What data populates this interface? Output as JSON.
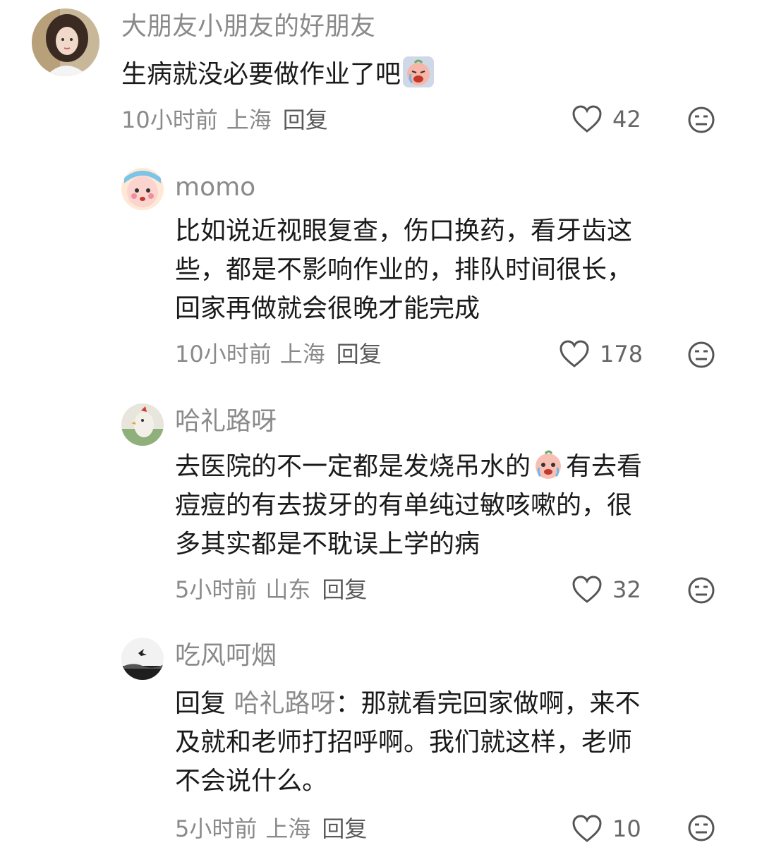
{
  "comments": [
    {
      "username": "大朋友小朋友的好朋友",
      "text_before": "生病就没必要做作业了吧",
      "emoji": "crying-peach-emoji",
      "text_after": "",
      "time": "10小时前",
      "location": "上海",
      "reply": "回复",
      "likes": "42"
    },
    {
      "username": "momo",
      "text_line1": "比如说近视眼复查，伤口换药，看牙齿这",
      "text_line2": "些，都是不影响作业的，排队时间很长，",
      "text_line3": "回家再做就会很晚才能完成",
      "time": "10小时前",
      "location": "上海",
      "reply": "回复",
      "likes": "178"
    },
    {
      "username": "哈礼路呀",
      "text_line1a": "去医院的不一定都是发烧吊水的",
      "emoji": "tearful-peach-emoji",
      "text_line1b": "有去看",
      "text_line2": "痘痘的有去拔牙的有单纯过敏咳嗽的，很",
      "text_line3": "多其实都是不耽误上学的病",
      "time": "5小时前",
      "location": "山东",
      "reply": "回复",
      "likes": "32"
    },
    {
      "username": "吃风呵烟",
      "reply_prefix": "回复",
      "reply_target": "哈礼路呀",
      "text_line1": "：那就看完回家做啊，来不",
      "text_line2": "及就和老师打招呼啊。我们就这样，老师",
      "text_line3": "不会说什么。",
      "time": "5小时前",
      "location": "上海",
      "reply": "回复",
      "likes": "10"
    }
  ],
  "colors": {
    "text": "#1a1a1a",
    "meta": "#8a8a8a",
    "icon": "#555555"
  }
}
